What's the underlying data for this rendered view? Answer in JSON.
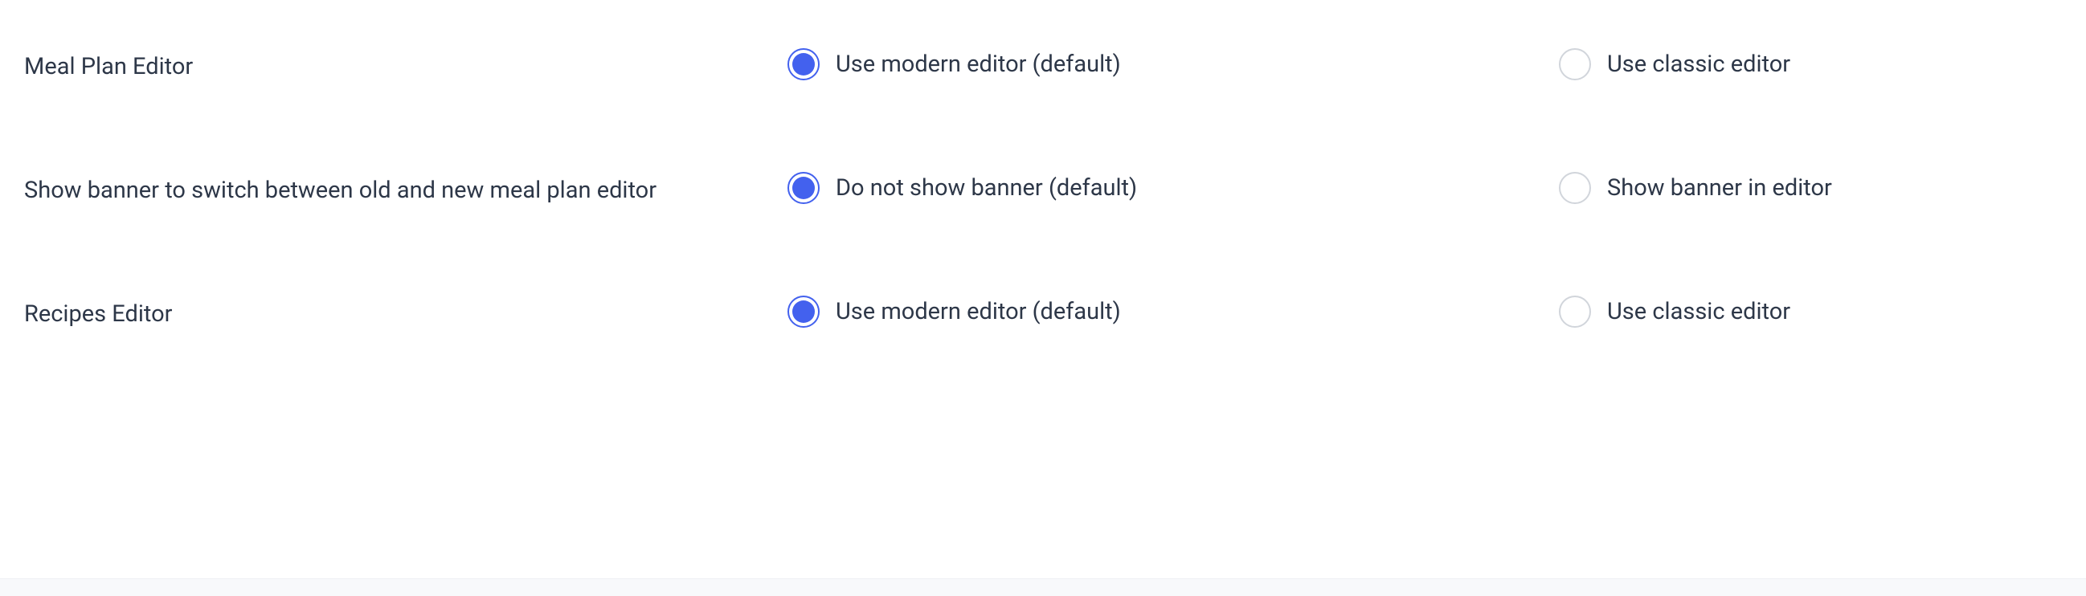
{
  "settings": [
    {
      "label": "Meal Plan Editor",
      "options": [
        {
          "label": "Use modern editor (default)",
          "selected": true
        },
        {
          "label": "Use classic editor",
          "selected": false
        }
      ]
    },
    {
      "label": "Show banner to switch between old and new meal plan editor",
      "options": [
        {
          "label": "Do not show banner (default)",
          "selected": true
        },
        {
          "label": "Show banner in editor",
          "selected": false
        }
      ]
    },
    {
      "label": "Recipes Editor",
      "options": [
        {
          "label": "Use modern editor (default)",
          "selected": true
        },
        {
          "label": "Use classic editor",
          "selected": false
        }
      ]
    }
  ]
}
